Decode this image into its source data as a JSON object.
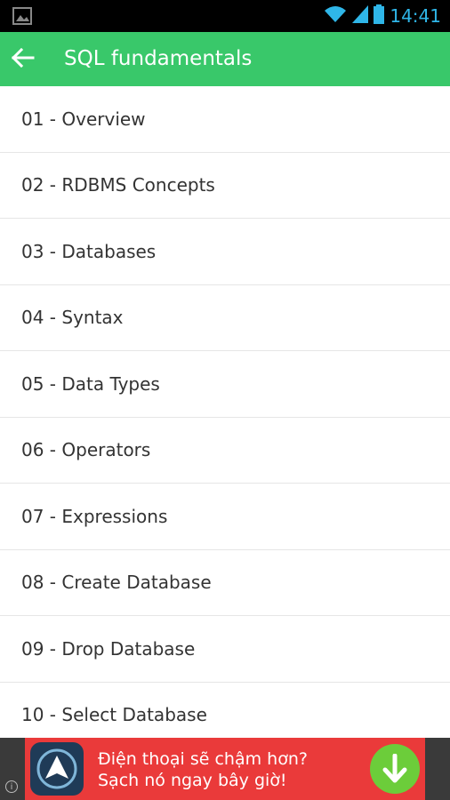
{
  "status_bar": {
    "time": "14:41",
    "icons": [
      "image-icon",
      "wifi-icon",
      "signal-icon",
      "battery-icon"
    ]
  },
  "app_bar": {
    "title": "SQL fundamentals",
    "back_icon": "arrow-back-icon",
    "color": "#39c86a"
  },
  "list": {
    "items": [
      {
        "label": "01 - Overview"
      },
      {
        "label": "02 - RDBMS Concepts"
      },
      {
        "label": "03 - Databases"
      },
      {
        "label": "04 - Syntax"
      },
      {
        "label": "05 - Data Types"
      },
      {
        "label": "06 - Operators"
      },
      {
        "label": "07 - Expressions"
      },
      {
        "label": "08 - Create Database"
      },
      {
        "label": "09 - Drop Database"
      },
      {
        "label": "10 - Select Database"
      }
    ]
  },
  "ad": {
    "line1": "Điện thoại sẽ chậm hơn?",
    "line2": "Sạch nó ngay bây giờ!",
    "color": "#ea3a3a"
  }
}
